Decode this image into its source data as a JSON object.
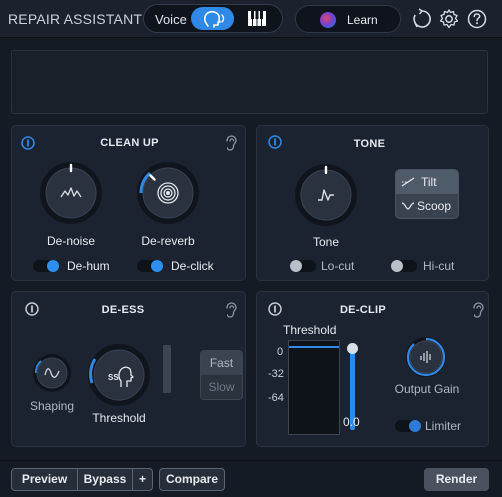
{
  "header": {
    "title": "REPAIR ASSISTANT",
    "mode_label": "Voice",
    "mode_selected": "voice",
    "learn_label": "Learn",
    "icons": [
      "history-icon",
      "gear-icon",
      "help-icon"
    ]
  },
  "modules": {
    "cleanup": {
      "title": "CLEAN UP",
      "knobs": [
        {
          "label": "De-noise"
        },
        {
          "label": "De-reverb"
        }
      ],
      "toggles": [
        {
          "label": "De-hum",
          "on": true
        },
        {
          "label": "De-click",
          "on": true
        }
      ]
    },
    "tone": {
      "title": "TONE",
      "knob_label": "Tone",
      "options": [
        "Tilt",
        "Scoop"
      ],
      "selected": "Tilt",
      "toggles": [
        {
          "label": "Lo-cut",
          "on": false
        },
        {
          "label": "Hi-cut",
          "on": false
        }
      ]
    },
    "deess": {
      "title": "DE-ESS",
      "shaping_label": "Shaping",
      "threshold_label": "Threshold",
      "speed_options": [
        "Fast",
        "Slow"
      ],
      "speed_selected": "Fast"
    },
    "declip": {
      "title": "DE-CLIP",
      "threshold_label": "Threshold",
      "scale": [
        "0",
        "-32",
        "-64"
      ],
      "threshold_value": "0.0",
      "output_gain_label": "Output Gain",
      "limiter_label": "Limiter",
      "limiter_on": true
    }
  },
  "bottom": {
    "preview_label": "Preview",
    "bypass_label": "Bypass",
    "plus_label": "+",
    "compare_label": "Compare",
    "render_label": "Render"
  },
  "colors": {
    "accent": "#2e8ae6",
    "background": "#151b25",
    "panel": "#1c2330"
  }
}
